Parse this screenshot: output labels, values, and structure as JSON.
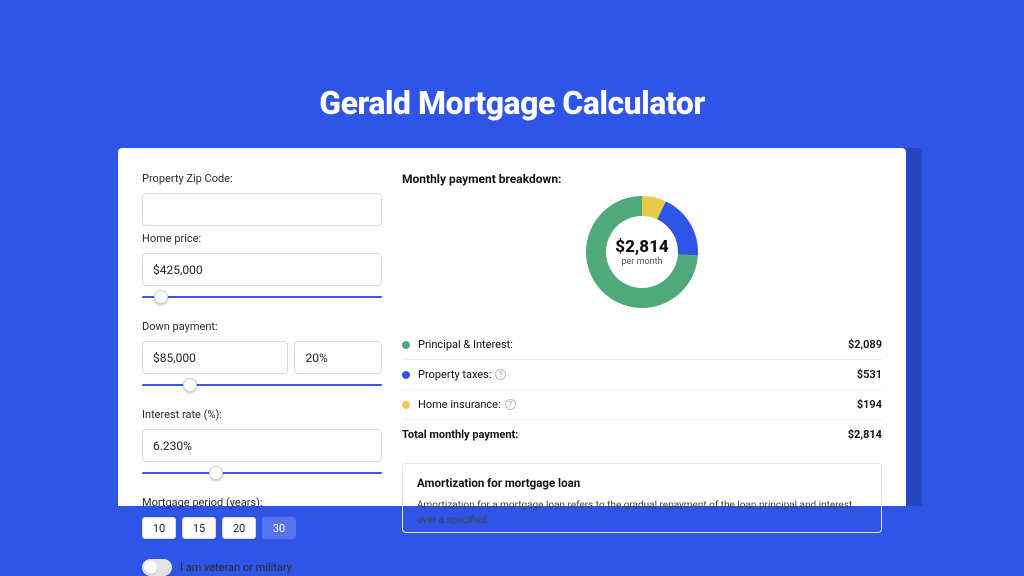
{
  "title": "Gerald Mortgage Calculator",
  "form": {
    "zip_label": "Property Zip Code:",
    "zip_value": "",
    "home_price_label": "Home price:",
    "home_price_value": "$425,000",
    "home_price_slider_pct": 8,
    "down_payment_label": "Down payment:",
    "down_payment_amount": "$85,000",
    "down_payment_pct": "20%",
    "down_payment_slider_pct": 20,
    "interest_rate_label": "Interest rate (%):",
    "interest_rate_value": "6.230%",
    "interest_rate_slider_pct": 31,
    "period_label": "Mortgage period (years):",
    "periods": [
      "10",
      "15",
      "20",
      "30"
    ],
    "period_selected_index": 3,
    "veteran_label": "I am veteran or military",
    "veteran_on": false
  },
  "breakdown": {
    "heading": "Monthly payment breakdown:",
    "center_value": "$2,814",
    "center_sub": "per month",
    "items": [
      {
        "name": "Principal & Interest:",
        "amount": "$2,089",
        "color": "#4fa97b",
        "help": false,
        "pct": 74
      },
      {
        "name": "Property taxes:",
        "amount": "$531",
        "color": "#2f55e6",
        "help": true,
        "pct": 19
      },
      {
        "name": "Home insurance:",
        "amount": "$194",
        "color": "#e9c94c",
        "help": true,
        "pct": 7
      }
    ],
    "total_label": "Total monthly payment:",
    "total_amount": "$2,814"
  },
  "amort": {
    "title": "Amortization for mortgage loan",
    "text": "Amortization for a mortgage loan refers to the gradual repayment of the loan principal and interest over a specified"
  },
  "chart_data": {
    "type": "pie",
    "title": "Monthly payment breakdown",
    "series": [
      {
        "name": "Principal & Interest",
        "value": 2089,
        "color": "#4fa97b"
      },
      {
        "name": "Property taxes",
        "value": 531,
        "color": "#2f55e6"
      },
      {
        "name": "Home insurance",
        "value": 194,
        "color": "#e9c94c"
      }
    ],
    "total": 2814,
    "unit": "USD per month"
  }
}
